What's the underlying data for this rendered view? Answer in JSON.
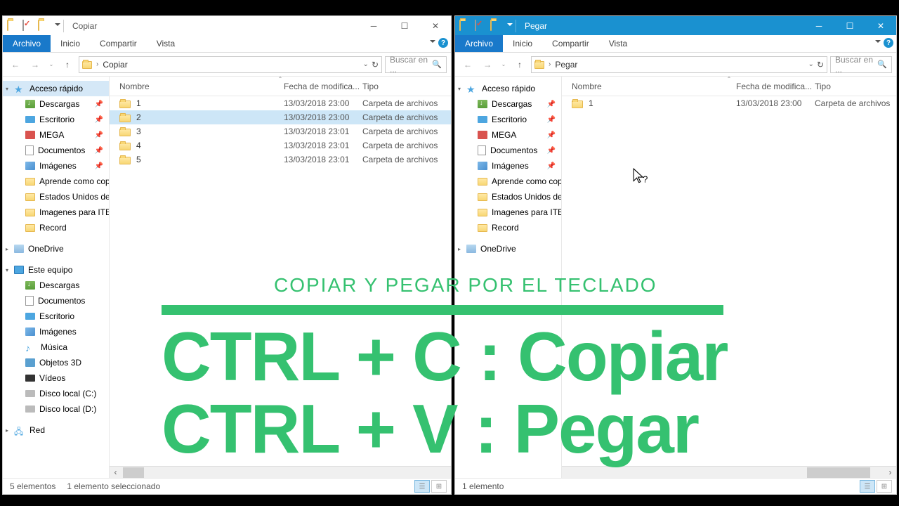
{
  "left": {
    "title": "Copiar",
    "ribbon": {
      "file": "Archivo",
      "home": "Inicio",
      "share": "Compartir",
      "view": "Vista"
    },
    "path": "Copiar",
    "search_ph": "Buscar en ...",
    "cols": {
      "name": "Nombre",
      "date": "Fecha de modifica...",
      "type": "Tipo"
    },
    "rows": [
      {
        "name": "1",
        "date": "13/03/2018 23:00",
        "type": "Carpeta de archivos"
      },
      {
        "name": "2",
        "date": "13/03/2018 23:00",
        "type": "Carpeta de archivos"
      },
      {
        "name": "3",
        "date": "13/03/2018 23:01",
        "type": "Carpeta de archivos"
      },
      {
        "name": "4",
        "date": "13/03/2018 23:01",
        "type": "Carpeta de archivos"
      },
      {
        "name": "5",
        "date": "13/03/2018 23:01",
        "type": "Carpeta de archivos"
      }
    ],
    "status": {
      "count": "5 elementos",
      "sel": "1 elemento seleccionado"
    }
  },
  "right": {
    "title": "Pegar",
    "ribbon": {
      "file": "Archivo",
      "home": "Inicio",
      "share": "Compartir",
      "view": "Vista"
    },
    "path": "Pegar",
    "search_ph": "Buscar en ...",
    "cols": {
      "name": "Nombre",
      "date": "Fecha de modifica...",
      "type": "Tipo"
    },
    "rows": [
      {
        "name": "1",
        "date": "13/03/2018 23:00",
        "type": "Carpeta de archivos"
      }
    ],
    "status": {
      "count": "1 elemento"
    }
  },
  "sidebar": {
    "quick": "Acceso rápido",
    "downloads": "Descargas",
    "desktop": "Escritorio",
    "mega": "MEGA",
    "documents": "Documentos",
    "pictures": "Imágenes",
    "f1": "Aprende como cop",
    "f2": "Estados Unidos desp",
    "f3": "Imagenes para ITEC",
    "f4": "Record",
    "onedrive": "OneDrive",
    "thispc": "Este equipo",
    "pc_dl": "Descargas",
    "pc_doc": "Documentos",
    "pc_desk": "Escritorio",
    "pc_img": "Imágenes",
    "pc_mus": "Música",
    "pc_3d": "Objetos 3D",
    "pc_vid": "Vídeos",
    "pc_c": "Disco local (C:)",
    "pc_d": "Disco local (D:)",
    "network": "Red"
  },
  "overlay": {
    "sub": "COPIAR Y PEGAR POR EL TECLADO",
    "l1": "CTRL + C : Copiar",
    "l2": "CTRL + V : Pegar"
  }
}
